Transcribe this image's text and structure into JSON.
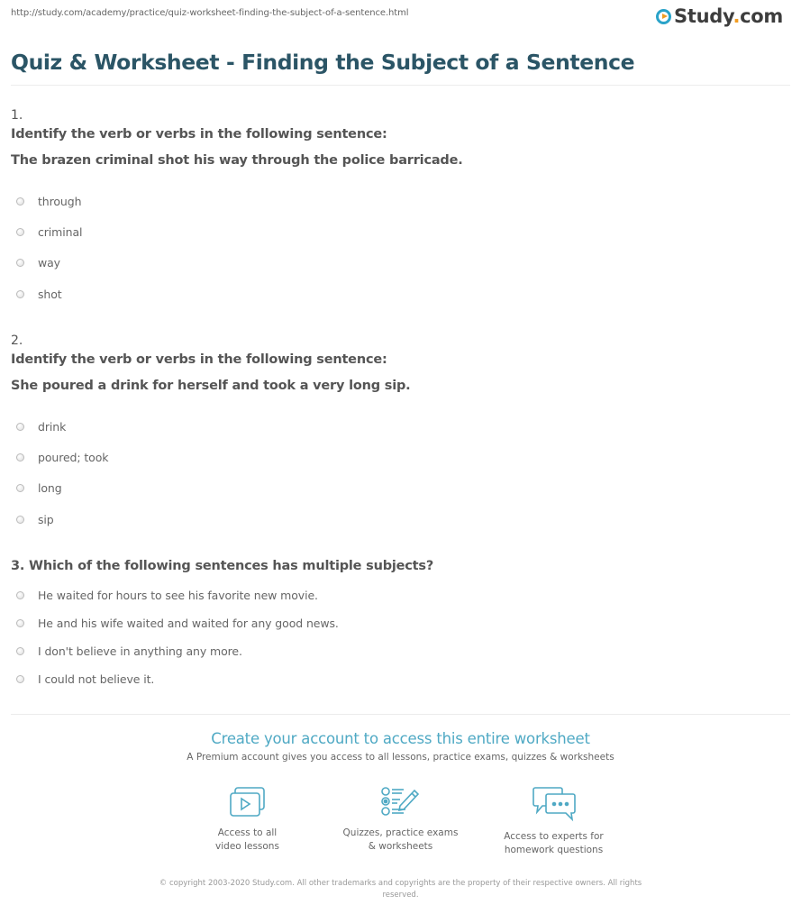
{
  "page": {
    "url": "http://study.com/academy/practice/quiz-worksheet-finding-the-subject-of-a-sentence.html",
    "logo": {
      "icon": "play-circle-icon",
      "text_main": "Study",
      "text_dot": ".",
      "text_tld": "com"
    },
    "title": "Quiz & Worksheet - Finding the Subject of a Sentence"
  },
  "questions": [
    {
      "number": "1.",
      "prompt": "Identify the verb or verbs in the following sentence:",
      "sentence": "The brazen criminal shot his way through the police barricade.",
      "options": [
        "through",
        "criminal",
        "way",
        "shot"
      ]
    },
    {
      "number": "2.",
      "prompt": "Identify the verb or verbs in the following sentence:",
      "sentence": "She poured a drink for herself and took a very long sip.",
      "options": [
        "drink",
        "poured; took",
        "long",
        "sip"
      ]
    },
    {
      "number": "",
      "prompt": "3. Which of the following sentences has multiple subjects?",
      "sentence": "",
      "options": [
        "He waited for hours to see his favorite new movie.",
        "He and his wife waited and waited for any good news.",
        "I don't believe in anything any more.",
        "I could not believe it."
      ]
    }
  ],
  "cta": {
    "title": "Create your account to access this entire worksheet",
    "subtitle": "A Premium account gives you access to all lessons, practice exams, quizzes & worksheets",
    "accent_color": "#4fa9c4",
    "features": [
      {
        "icon": "video-lessons-icon",
        "line1": "Access to all",
        "line2": "video lessons"
      },
      {
        "icon": "quiz-checklist-icon",
        "line1": "Quizzes, practice exams",
        "line2": "& worksheets"
      },
      {
        "icon": "chat-bubbles-icon",
        "line1": "Access to experts for",
        "line2": "homework questions"
      }
    ]
  },
  "footer": {
    "copyright": "© copyright 2003-2020 Study.com. All other trademarks and copyrights are the property of their respective owners. All rights reserved."
  }
}
